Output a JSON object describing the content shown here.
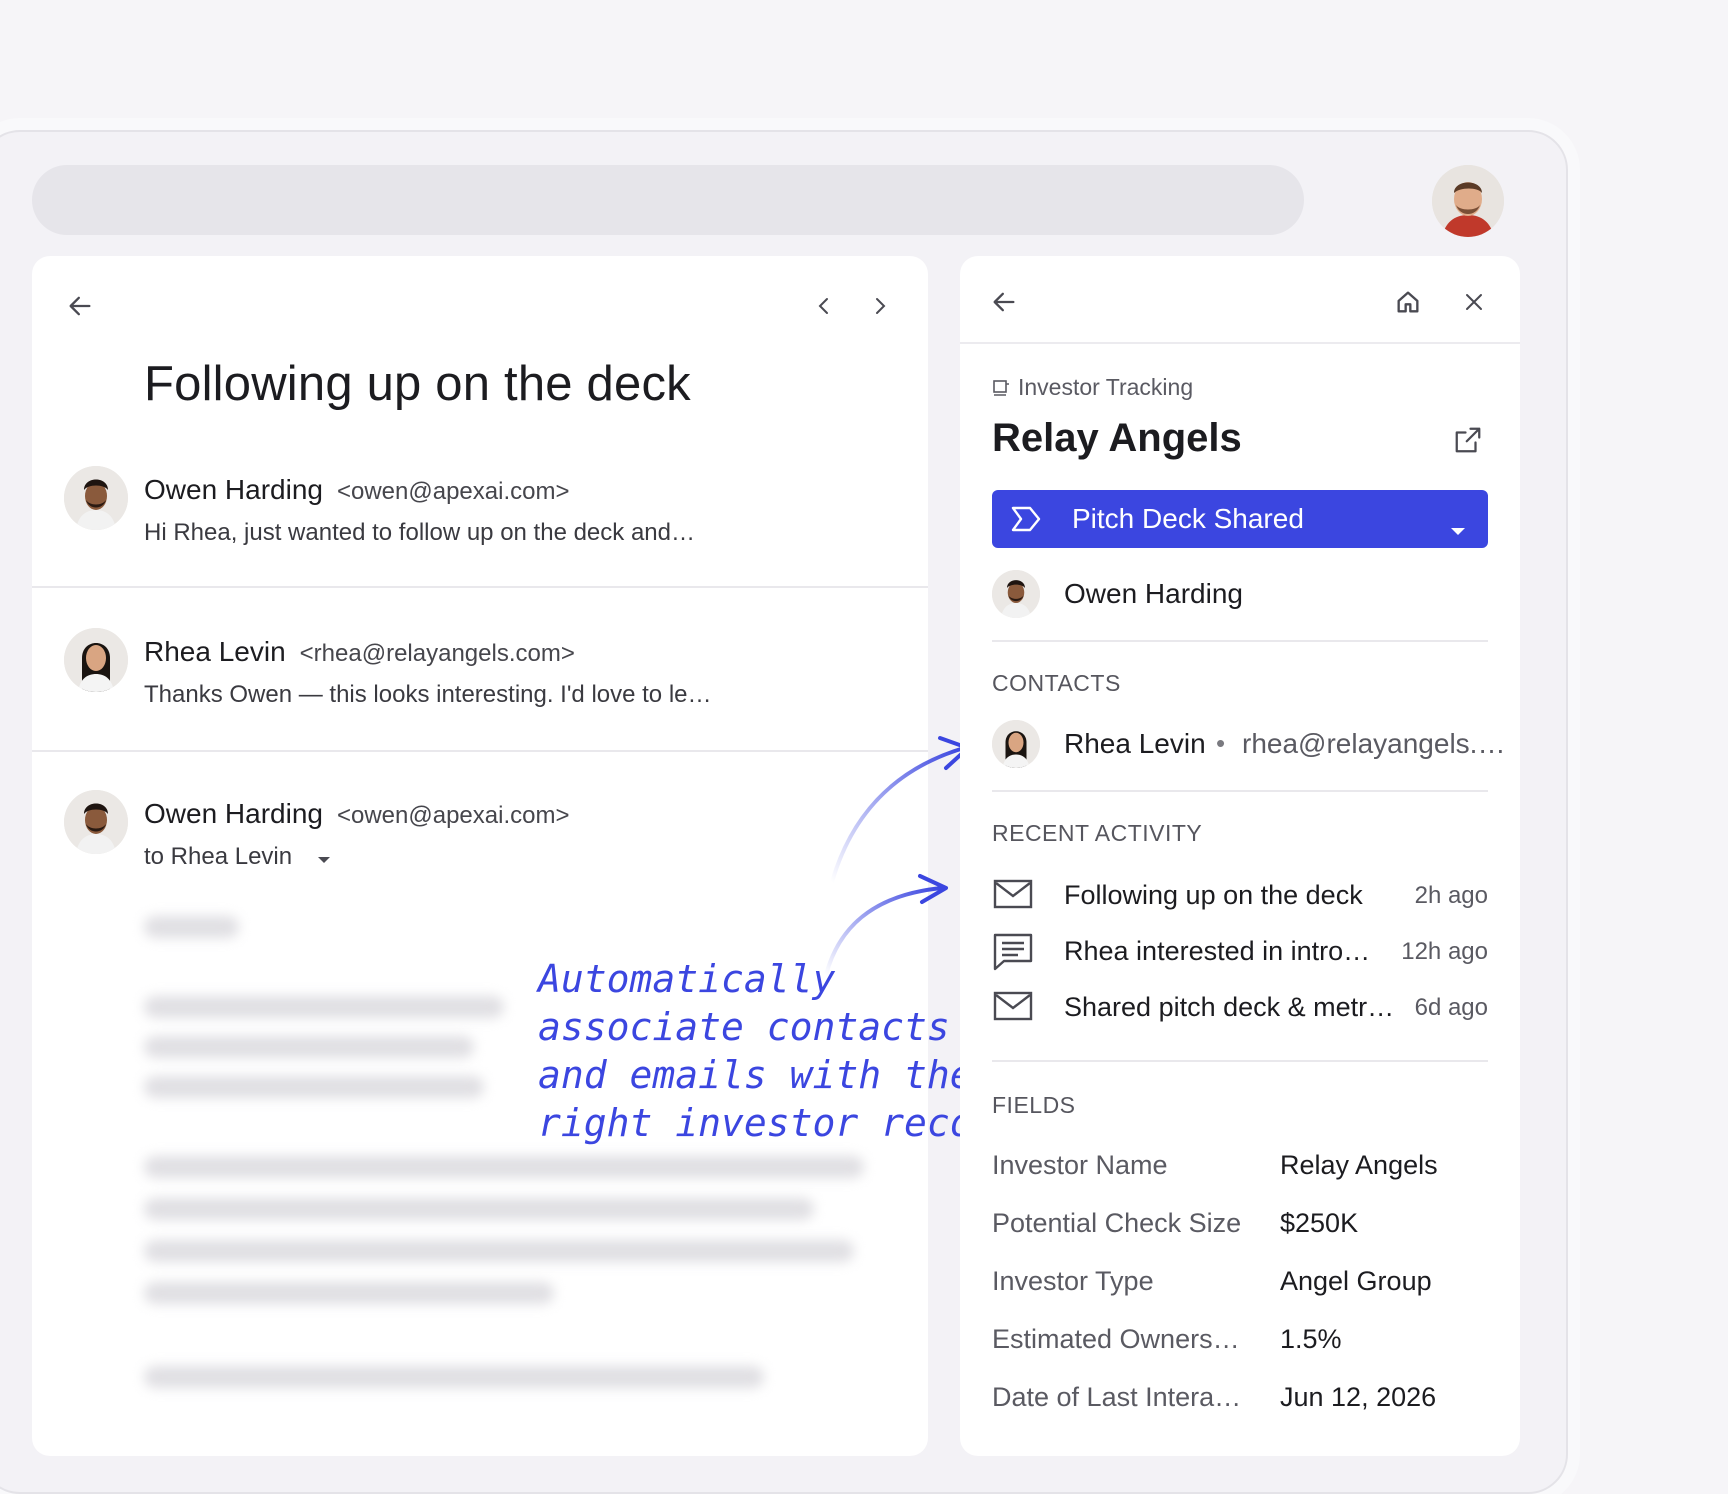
{
  "email": {
    "subject": "Following up on the deck",
    "threads": [
      {
        "sender": "Owen Harding",
        "address": "<owen@apexai.com>",
        "snippet": "Hi Rhea, just wanted to follow up on the deck and…"
      },
      {
        "sender": "Rhea Levin",
        "address": "<rhea@relayangels.com>",
        "snippet": "Thanks Owen — this looks interesting. I'd love to le…"
      },
      {
        "sender": "Owen Harding",
        "address": "<owen@apexai.com>",
        "recipient": "to Rhea Levin"
      }
    ]
  },
  "annotation": {
    "lines": [
      "Automatically",
      "associate contacts",
      "and emails with the",
      "right investor record"
    ],
    "color": "#3b46e0"
  },
  "sidebar": {
    "breadcrumb": "Investor Tracking",
    "title": "Relay Angels",
    "stage": "Pitch Deck Shared",
    "owner": "Owen Harding",
    "contacts_heading": "CONTACTS",
    "contact": {
      "name": "Rhea Levin",
      "separator": "•",
      "email": "rhea@relayangels.…"
    },
    "activity_heading": "RECENT ACTIVITY",
    "activity": [
      {
        "icon": "mail-icon",
        "title": "Following up on the deck",
        "time": "2h ago"
      },
      {
        "icon": "note-icon",
        "title": "Rhea interested in intro…",
        "time": "12h ago"
      },
      {
        "icon": "mail-icon",
        "title": "Shared pitch deck & metr…",
        "time": "6d ago"
      }
    ],
    "fields_heading": "FIELDS",
    "fields": [
      {
        "label": "Investor Name",
        "value": "Relay Angels"
      },
      {
        "label": "Potential Check Size",
        "value": "$250K"
      },
      {
        "label": "Investor Type",
        "value": "Angel Group"
      },
      {
        "label": "Estimated Owners…",
        "value": "1.5%"
      },
      {
        "label": "Date of Last Intera…",
        "value": "Jun 12, 2026"
      }
    ]
  },
  "colors": {
    "accent": "#3b46e0",
    "background": "#f6f5f8"
  }
}
